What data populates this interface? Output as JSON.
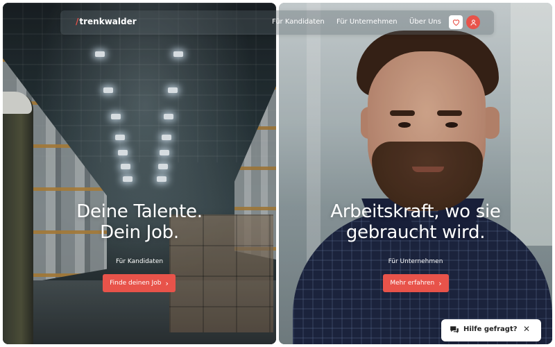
{
  "brand": {
    "logo": "trenkwalder",
    "logo_mark": "/"
  },
  "nav": {
    "links": [
      "Für Kandidaten",
      "Für Unternehmen",
      "Über Uns"
    ],
    "favorites_icon": "heart-icon",
    "account_icon": "user-icon"
  },
  "hero_left": {
    "title_line1": "Deine Talente.",
    "title_line2": "Dein Job.",
    "subtitle": "Für Kandidaten",
    "cta_label": "Finde deinen Job"
  },
  "hero_right": {
    "title_line1": "Arbeitskraft, wo sie",
    "title_line2": "gebraucht wird.",
    "subtitle": "Für Unternehmen",
    "cta_label": "Mehr erfahren"
  },
  "help_widget": {
    "label": "Hilfe gefragt?",
    "icon": "chat-icon",
    "close_icon": "close-icon"
  },
  "colors": {
    "accent": "#e8534a",
    "text_on_image": "#ffffff"
  }
}
